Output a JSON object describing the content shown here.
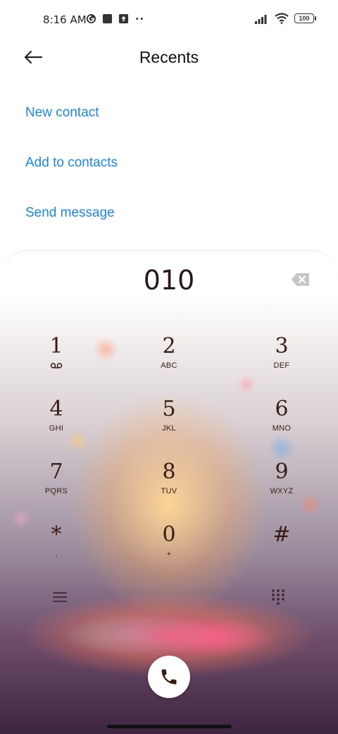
{
  "status_bar": {
    "time": "8:16 AM",
    "battery": "100",
    "icons": [
      "google-icon",
      "square-icon",
      "upload-icon",
      "more-dots-icon",
      "signal-icon",
      "wifi-icon",
      "battery-icon"
    ]
  },
  "header": {
    "title": "Recents",
    "back_icon": "arrow-left-icon"
  },
  "actions": {
    "new_contact": "New contact",
    "add_to_contacts": "Add to contacts",
    "send_message": "Send message"
  },
  "dialer": {
    "number": "010",
    "keys": [
      {
        "digit": "1",
        "letters": ""
      },
      {
        "digit": "2",
        "letters": "ABC"
      },
      {
        "digit": "3",
        "letters": "DEF"
      },
      {
        "digit": "4",
        "letters": "GHI"
      },
      {
        "digit": "5",
        "letters": "JKL"
      },
      {
        "digit": "6",
        "letters": "MNO"
      },
      {
        "digit": "7",
        "letters": "PQRS"
      },
      {
        "digit": "8",
        "letters": "TUV"
      },
      {
        "digit": "9",
        "letters": "WXYZ"
      },
      {
        "digit": "*",
        "letters": ","
      },
      {
        "digit": "0",
        "letters": "+"
      },
      {
        "digit": "#",
        "letters": ""
      }
    ],
    "key1_icon": "voicemail-icon"
  },
  "colors": {
    "accent": "#1a86e6",
    "digit": "#3a1c16",
    "number": "#2a1520"
  }
}
